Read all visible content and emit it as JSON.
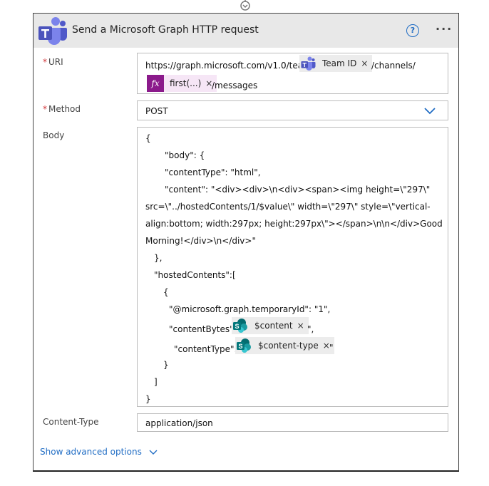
{
  "card": {
    "title": "Send a Microsoft Graph HTTP request",
    "help_label": "?",
    "more_label": "···"
  },
  "uri": {
    "label": "URI",
    "required_mark": "*",
    "text_prefix": "https://graph.microsoft.com/v1.0/teams/",
    "token_team": "Team ID",
    "text_channels": "/channels/",
    "token_first": "first(...)",
    "text_messages": "/messages"
  },
  "method": {
    "label": "Method",
    "required_mark": "*",
    "value": "POST"
  },
  "body": {
    "label": "Body",
    "lines": [
      "{",
      "\"body\": {",
      "\"contentType\": \"html\",",
      "\"content\": \"<div><div>\\n<div><span><img height=\\\"297\\\"",
      "src=\\\"../hostedContents/1/$value\\\" width=\\\"297\\\" style=\\\"vertical-",
      "align:bottom; width:297px; height:297px\\\"></span>\\n\\n</div>Good",
      "Morning!</div>\\n</div>\"",
      "},",
      "\"hostedContents\":[",
      "{",
      "\"@microsoft.graph.temporaryId\": \"1\",",
      "\"contentBytes\": \"",
      "\",",
      "\"contentType\": \"",
      "\"",
      "}",
      "]",
      "}"
    ],
    "token_content": "$content",
    "token_content_type": "$content-type",
    "token_close": "×"
  },
  "content_type": {
    "label": "Content-Type",
    "value": "application/json"
  },
  "advanced": {
    "label": "Show advanced options"
  },
  "colors": {
    "accent": "#1f6cc4",
    "required": "#d13438",
    "header_bg": "#e8e8e8",
    "fx_bg": "#8b1a8b",
    "sharepoint": "#038387"
  },
  "icons": {
    "card": "teams-icon",
    "team_token": "teams-icon",
    "first_token": "fx-icon",
    "content_tokens": "sharepoint-icon",
    "method_dropdown": "chevron-down-icon",
    "advanced": "chevron-down-icon"
  }
}
